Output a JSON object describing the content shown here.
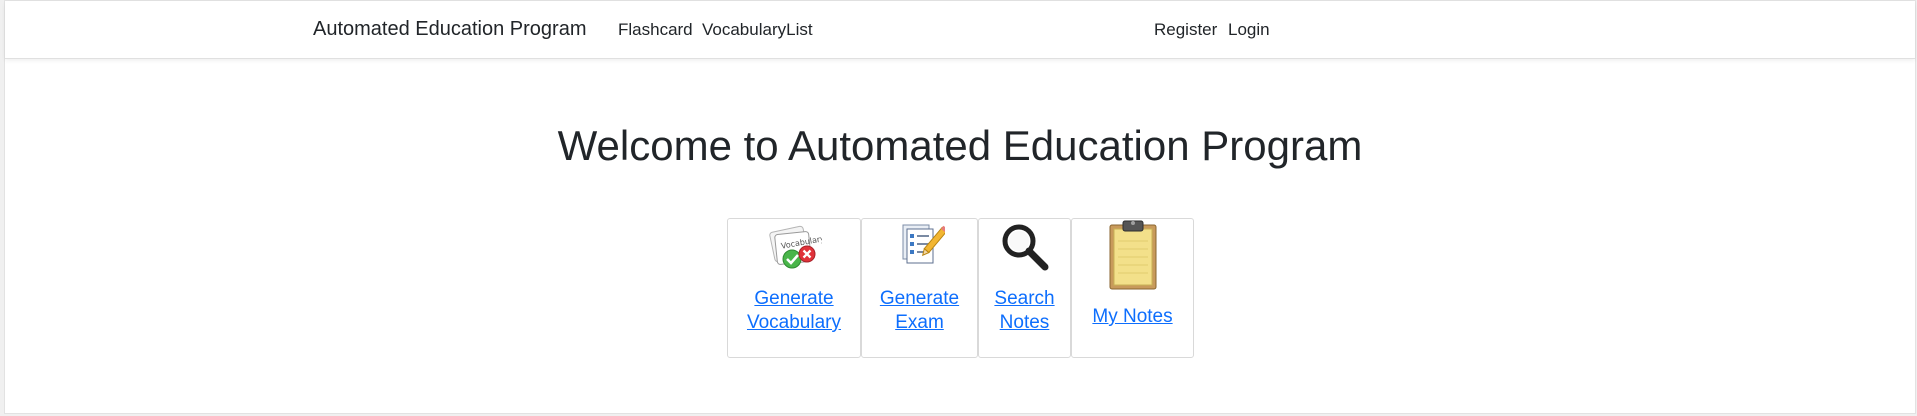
{
  "navbar": {
    "brand": "Automated Education Program",
    "links": [
      {
        "label": "Flashcard"
      },
      {
        "label": "VocabularyList"
      }
    ],
    "auth": [
      {
        "label": "Register"
      },
      {
        "label": "Login"
      }
    ]
  },
  "main": {
    "heading": "Welcome to Automated Education Program",
    "cards": [
      {
        "line1": "Generate",
        "line2": "Vocabulary",
        "icon": "vocabulary-check-icon"
      },
      {
        "line1": "Generate",
        "line2": "Exam",
        "icon": "exam-pencil-icon"
      },
      {
        "line1": "Search",
        "line2": "Notes",
        "icon": "magnifier-icon"
      },
      {
        "line1": "My Notes",
        "icon": "clipboard-icon"
      }
    ]
  },
  "colors": {
    "link": "#0d6efd",
    "text": "#212529",
    "card_border": "#d9d9d9",
    "notes_paper": "#f3e08a"
  }
}
